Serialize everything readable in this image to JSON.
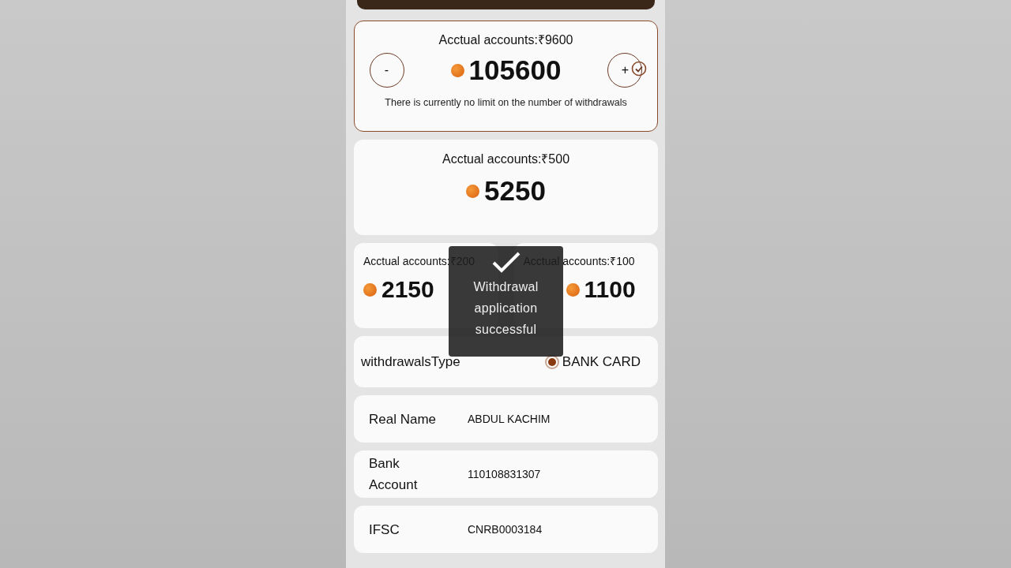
{
  "amount_options": [
    {
      "kind": "stepper",
      "label": "Acctual accounts:₹9600",
      "amount": "105600",
      "selected": true,
      "minus": "-",
      "plus": "+",
      "note": "There is currently no limit on the number of withdrawals"
    },
    {
      "kind": "wide",
      "label": "Acctual accounts:₹500",
      "amount": "5250",
      "selected": false
    },
    {
      "kind": "half",
      "label": "Acctual accounts:₹200",
      "amount": "2150",
      "selected": false
    },
    {
      "kind": "half",
      "label": "Acctual accounts:₹100",
      "amount": "1100",
      "selected": false
    }
  ],
  "withdrawals_type": {
    "label": "withdrawalsType",
    "options": [
      {
        "label": "BANK CARD",
        "selected": true
      }
    ]
  },
  "fields": [
    {
      "label": "Real Name",
      "value": "ABDUL KACHIM"
    },
    {
      "label": "Bank Account",
      "value": "110108831307"
    },
    {
      "label": "IFSC",
      "value": "CNRB0003184"
    }
  ],
  "toast": {
    "message": "Withdrawal application successful"
  }
}
